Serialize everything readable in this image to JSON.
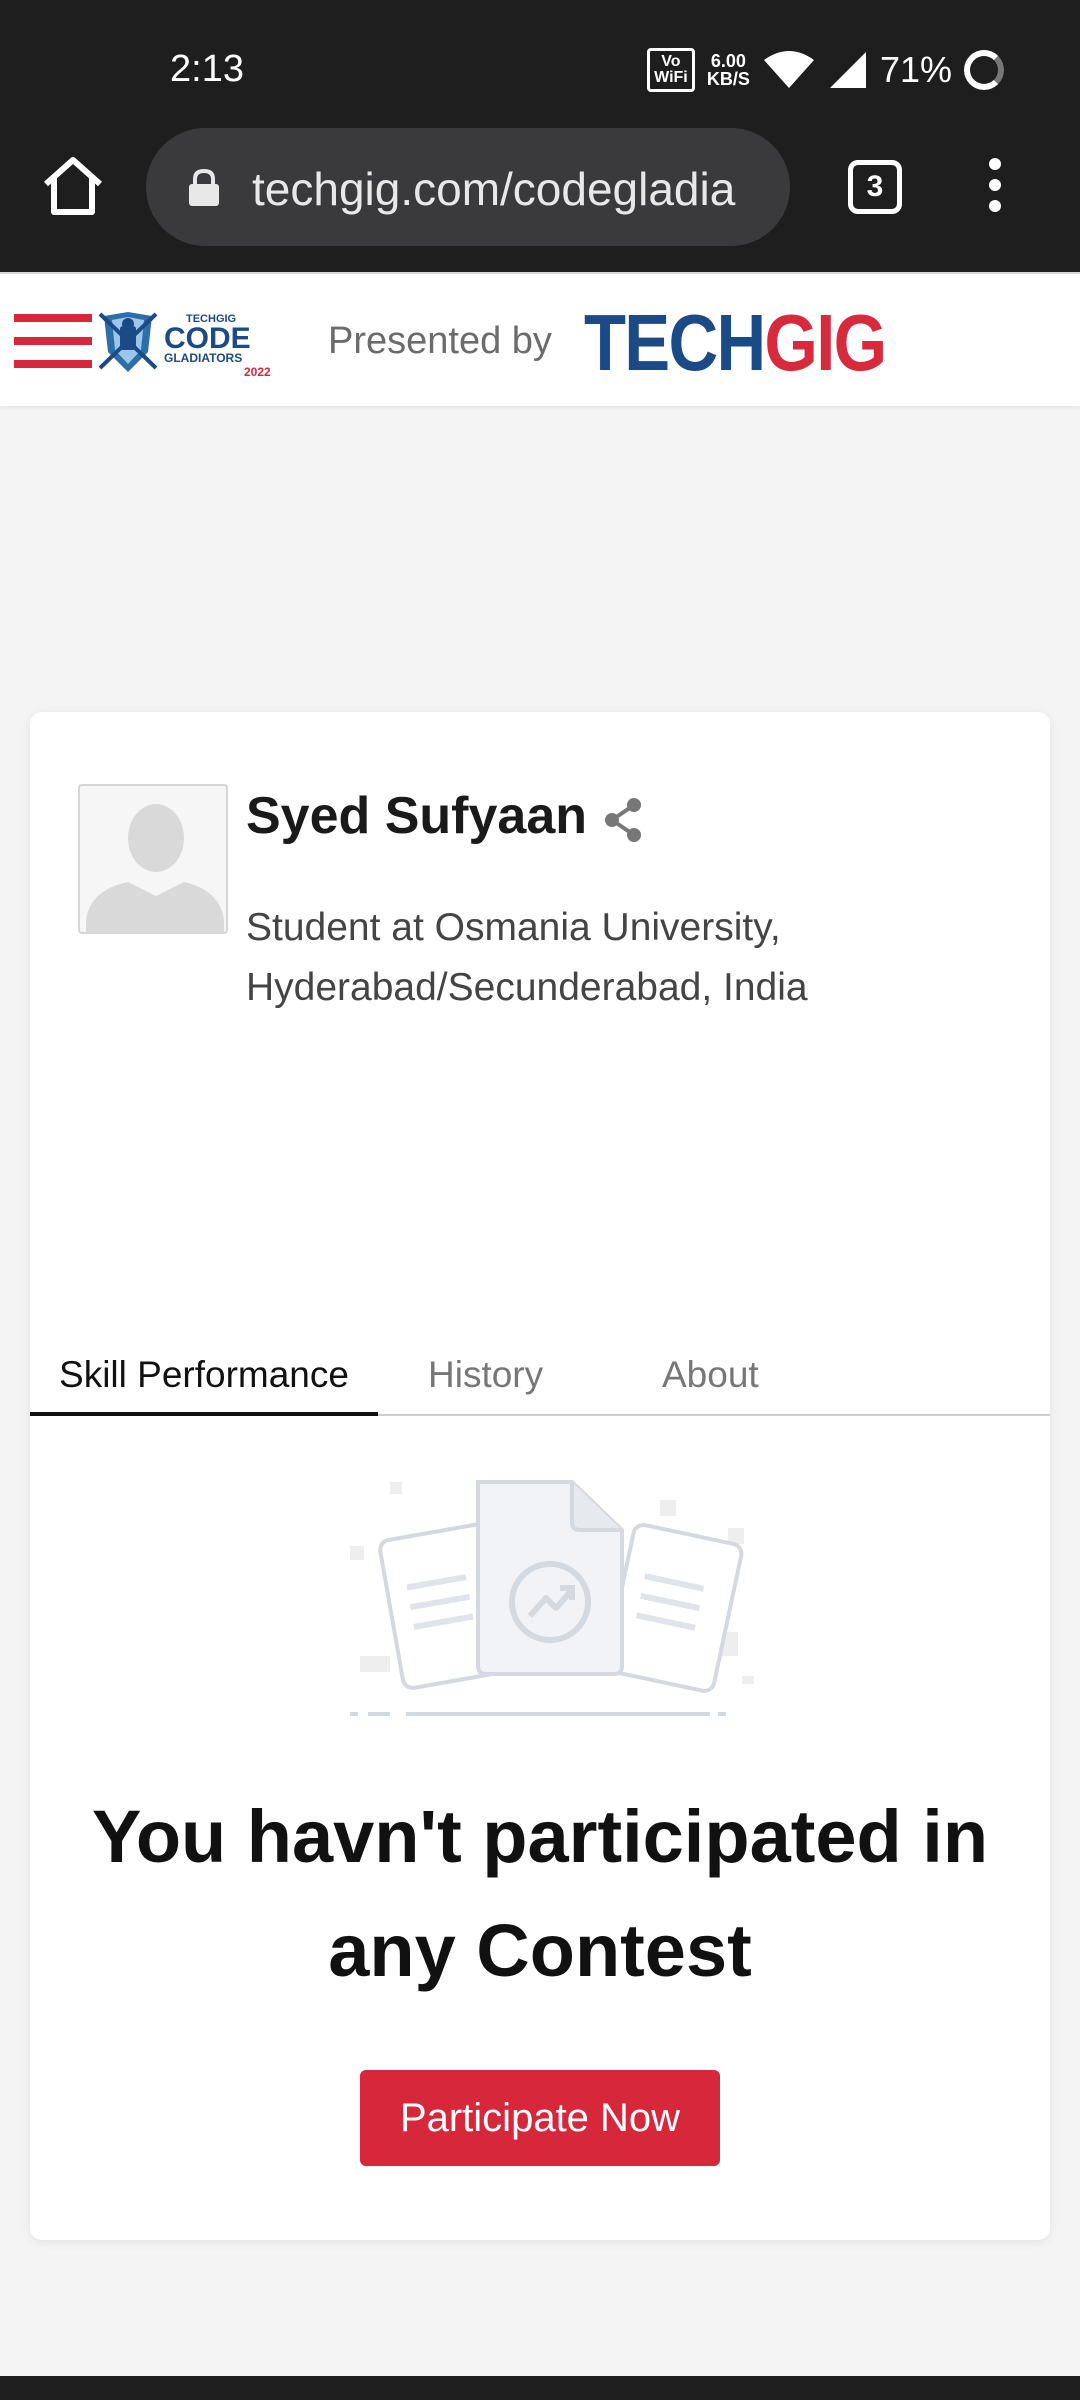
{
  "status_bar": {
    "time": "2:13",
    "vowifi": "Vo WiFi",
    "speed_value": "6.00",
    "speed_unit": "KB/S",
    "battery": "71%"
  },
  "browser": {
    "url": "techgig.com/codegladia",
    "tab_count": "3"
  },
  "header": {
    "presented_by": "Presented by",
    "techgig_logo_part1": "TECH",
    "techgig_logo_part2": "GIG",
    "event_logo_text": [
      "TECHGIG",
      "CODE",
      "GLADIATORS",
      "2022"
    ],
    "brand_colors": {
      "red": "#d7283b",
      "navy": "#1b4a86"
    }
  },
  "profile": {
    "name": "Syed Sufyaan",
    "subtitle": "Student at Osmania University, Hyderabad/Secunderabad, India"
  },
  "tabs": [
    {
      "label": "Skill Performance",
      "active": true
    },
    {
      "label": "History",
      "active": false
    },
    {
      "label": "About",
      "active": false
    }
  ],
  "empty_state": {
    "message": "You havn't participated in any Contest",
    "cta": "Participate Now"
  }
}
